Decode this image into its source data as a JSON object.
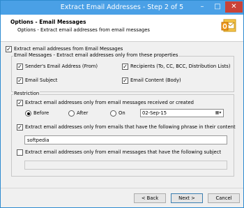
{
  "window": {
    "title": "Extract Email Addresses - Step 2 of 5",
    "minimize": "–",
    "maximize": "□",
    "close": "✕"
  },
  "header": {
    "title": "Options - Email Messages",
    "subtitle": "Options - Extract email addresses from email messages"
  },
  "main": {
    "extract_from_messages": {
      "label": "Extract email addresses from Email Messages",
      "checked": true
    },
    "properties_group": {
      "legend": "Email Messages - Extract email addresses only from these properties",
      "items": [
        {
          "label": "Sender's Email Address (From)",
          "checked": true
        },
        {
          "label": "Recipients (To, CC, BCC, Distribution Lists)",
          "checked": true
        },
        {
          "label": "Email Subject",
          "checked": true
        },
        {
          "label": "Email Content (Body)",
          "checked": true
        }
      ]
    },
    "restriction_group": {
      "legend": "Restriction",
      "date_restriction": {
        "label": "Extract email addresses only from email messages received or created",
        "checked": true
      },
      "date_options": [
        {
          "label": "Before",
          "selected": true
        },
        {
          "label": "After",
          "selected": false
        },
        {
          "label": "On",
          "selected": false
        }
      ],
      "date_value": "02-Sep-15",
      "phrase_restriction": {
        "label": "Extract email addresses only from emails that have the following phrase in their content",
        "checked": true
      },
      "phrase_value": "softpedia",
      "subject_restriction": {
        "label": "Extract email addresses only from email messages that have the following subject",
        "checked": false
      },
      "subject_value": ""
    }
  },
  "footer": {
    "back": "< Back",
    "next": "Next >",
    "cancel": "Cancel"
  },
  "colors": {
    "titlebar": "#4aa0e6",
    "close": "#c94237"
  }
}
